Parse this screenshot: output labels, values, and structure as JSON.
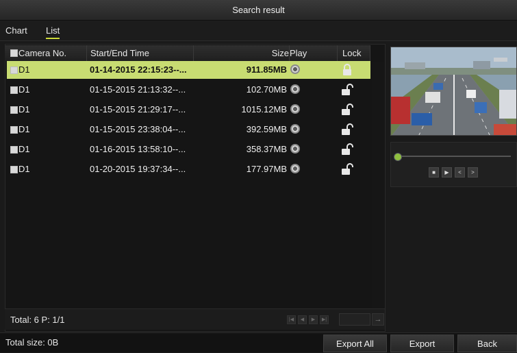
{
  "window": {
    "title": "Search result"
  },
  "tabs": [
    {
      "label": "Chart",
      "active": false
    },
    {
      "label": "List",
      "active": true
    }
  ],
  "table": {
    "columns": [
      "Camera No.",
      "Start/End Time",
      "Size",
      "Play",
      "Lock"
    ],
    "rows": [
      {
        "camera": "D1",
        "time": "01-14-2015 22:15:23--...",
        "size": "911.85MB",
        "locked": true,
        "selected": true
      },
      {
        "camera": "D1",
        "time": "01-15-2015 21:13:32--...",
        "size": "102.70MB",
        "locked": false,
        "selected": false
      },
      {
        "camera": "D1",
        "time": "01-15-2015 21:29:17--...",
        "size": "1015.12MB",
        "locked": false,
        "selected": false
      },
      {
        "camera": "D1",
        "time": "01-15-2015 23:38:04--...",
        "size": "392.59MB",
        "locked": false,
        "selected": false
      },
      {
        "camera": "D1",
        "time": "01-16-2015 13:58:10--...",
        "size": "358.37MB",
        "locked": false,
        "selected": false
      },
      {
        "camera": "D1",
        "time": "01-20-2015 19:37:34--...",
        "size": "177.97MB",
        "locked": false,
        "selected": false
      }
    ]
  },
  "pagination": {
    "summary": "Total: 6  P: 1/1",
    "page_input": ""
  },
  "footer": {
    "total_size": "Total size: 0B"
  },
  "buttons": {
    "export_all": "Export All",
    "export": "Export",
    "back": "Back"
  },
  "colors": {
    "selected_row": "#c8dc72",
    "tab_underline": "#cddc39"
  }
}
